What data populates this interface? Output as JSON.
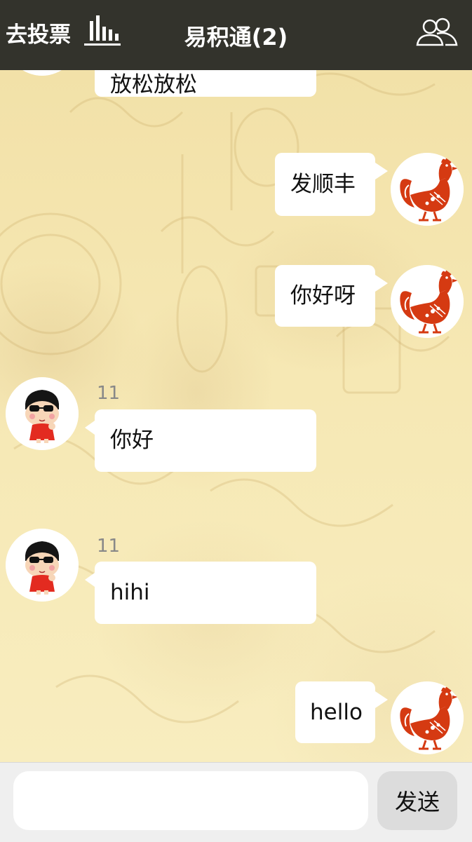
{
  "header": {
    "vote_label": "去投票",
    "vote_icon": "bar-chart-icon",
    "title": "易积通(2)",
    "members_icon": "group-users-icon",
    "background": "#33332c"
  },
  "messages": [
    {
      "side": "left",
      "text": "放松放松",
      "avatar": "crayon-boy-avatar"
    },
    {
      "side": "right",
      "text": "发顺丰",
      "avatar": "rooster-papercut-avatar"
    },
    {
      "side": "right",
      "text": "你好呀",
      "avatar": "rooster-papercut-avatar"
    },
    {
      "side": "left",
      "sender": "11",
      "text": "你好",
      "avatar": "crayon-boy-avatar"
    },
    {
      "side": "left",
      "sender": "11",
      "text": "hihi",
      "avatar": "crayon-boy-avatar"
    },
    {
      "side": "right",
      "text": "hello",
      "avatar": "rooster-papercut-avatar"
    }
  ],
  "composer": {
    "input_value": "",
    "send_label": "发送"
  },
  "colors": {
    "rooster_red": "#d53a12",
    "chat_background": "#f5eab8"
  }
}
